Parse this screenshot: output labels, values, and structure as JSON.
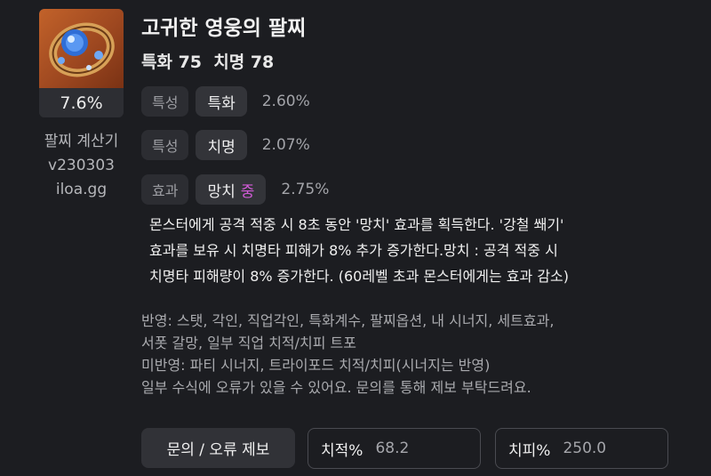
{
  "item": {
    "percent": "7.6%",
    "name": "고귀한 영웅의 팔찌",
    "stats": "특화 75  치명 78"
  },
  "calculator": {
    "name": "팔찌 계산기",
    "version": "v230303",
    "site": "iloa.gg"
  },
  "rows": [
    {
      "tag": "특성",
      "chip": "특화",
      "grade": "",
      "value": "2.60%"
    },
    {
      "tag": "특성",
      "chip": "치명",
      "grade": "",
      "value": "2.07%"
    },
    {
      "tag": "효과",
      "chip": "망치",
      "grade": "중",
      "value": "2.75%"
    }
  ],
  "description": {
    "line1": "몬스터에게 공격 적중 시 8초 동안 '망치' 효과를 획득한다. '강철 쐐기'",
    "line2": "효과를 보유 시 치명타 피해가 8% 추가 증가한다.망치 : 공격 적중 시",
    "line3": "치명타 피해량이 8% 증가한다. (60레벨 초과 몬스터에게는 효과 감소)"
  },
  "notes": {
    "line1": "반영: 스탯, 각인, 직업각인, 특화계수, 팔찌옵션, 내 시너지, 세트효과,",
    "line2": "서폿 갈망, 일부 직업 치적/치피 트포",
    "line3": "미반영: 파티 시너지, 트라이포드 치적/치피(시너지는 반영)",
    "line4": "일부 수식에 오류가 있을 수 있어요. 문의를 통해 제보 부탁드려요."
  },
  "footer": {
    "report_button": "문의 / 오류 제보",
    "crit_rate_label": "치적%",
    "crit_rate_value": "68.2",
    "crit_dmg_label": "치피%",
    "crit_dmg_value": "250.0"
  },
  "colors": {
    "background": "#1c1d21",
    "grade_mid": "#d35bd8",
    "item_bg": "#b0562a"
  },
  "icons": {
    "item": "bracelet-icon"
  }
}
